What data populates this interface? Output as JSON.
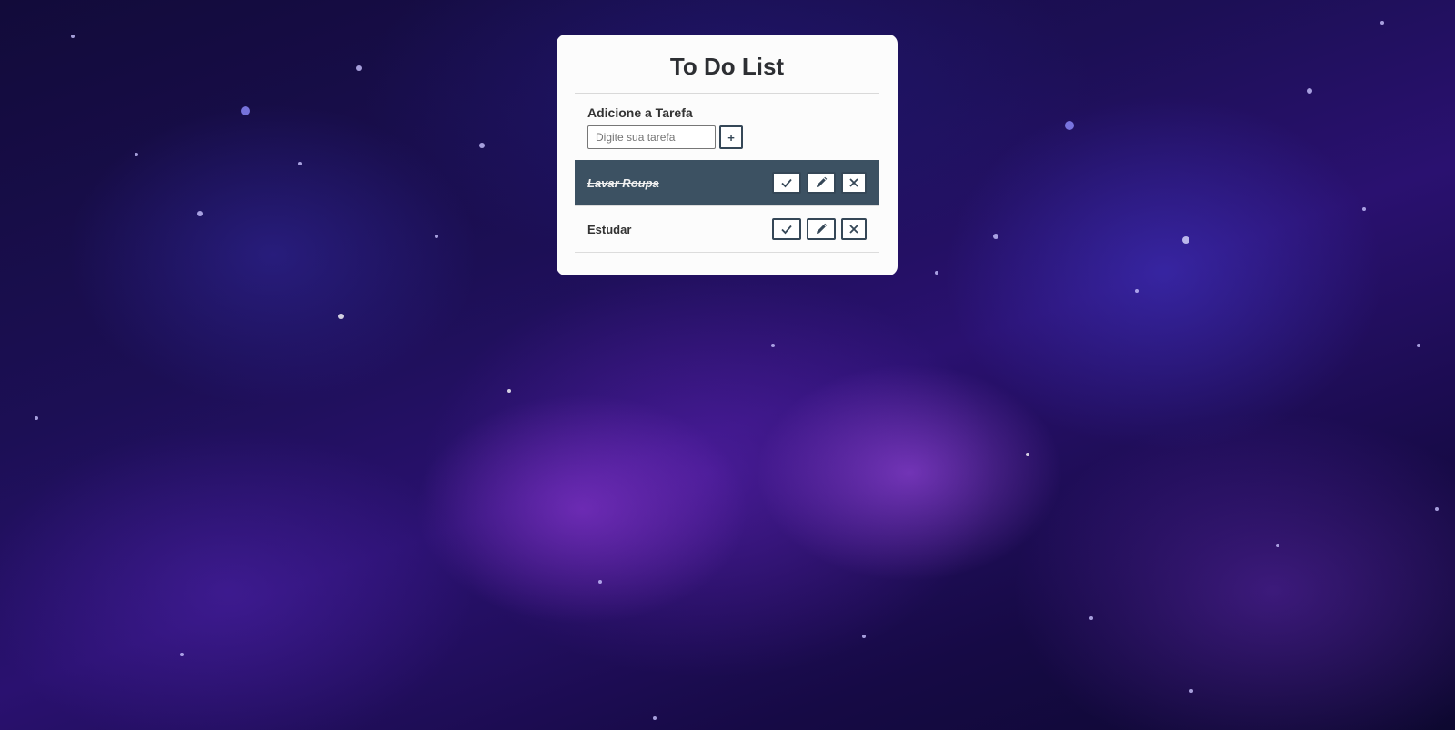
{
  "app": {
    "title": "To Do List"
  },
  "add_task": {
    "label": "Adicione a Tarefa",
    "input_value": "",
    "input_placeholder": "Digite sua tarefa",
    "add_button_label": "+"
  },
  "todos": [
    {
      "text": "Lavar Roupa",
      "done": true
    },
    {
      "text": "Estudar",
      "done": false
    }
  ],
  "icons": {
    "complete": "check-icon",
    "edit": "pencil-icon",
    "remove": "close-icon"
  },
  "colors": {
    "accent": "#354757",
    "done_row_bg": "#3c5162",
    "card_bg": "#fcfcfc"
  }
}
